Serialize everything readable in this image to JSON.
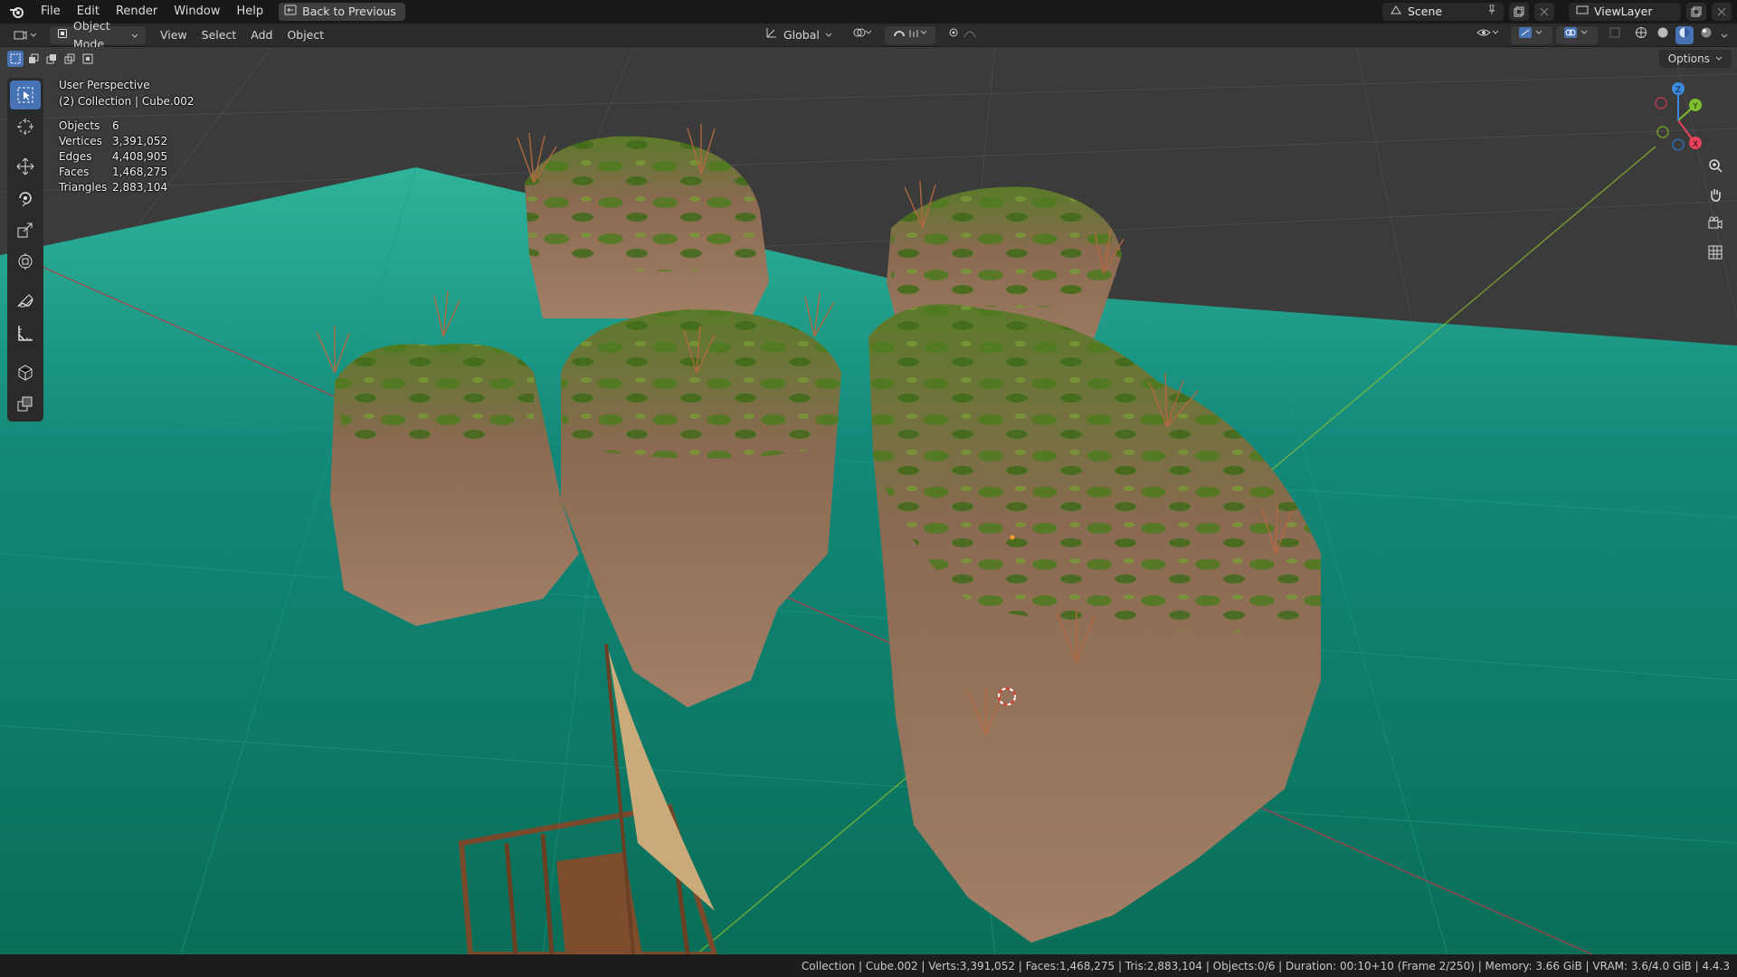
{
  "topbar": {
    "menus": [
      "File",
      "Edit",
      "Render",
      "Window",
      "Help"
    ],
    "back_label": "Back to Previous",
    "scene_name": "Scene",
    "viewlayer_name": "ViewLayer"
  },
  "header": {
    "mode": "Object Mode",
    "menus": [
      "View",
      "Select",
      "Add",
      "Object"
    ],
    "transform_orientation": "Global"
  },
  "viewport": {
    "options_label": "Options",
    "perspective": "User Perspective",
    "collection_line": "(2) Collection | Cube.002",
    "stats": [
      {
        "label": "Objects",
        "value": "6"
      },
      {
        "label": "Vertices",
        "value": "3,391,052"
      },
      {
        "label": "Edges",
        "value": "4,408,905"
      },
      {
        "label": "Faces",
        "value": "1,468,275"
      },
      {
        "label": "Triangles",
        "value": "2,883,104"
      }
    ],
    "gizmo": {
      "x": "X",
      "y": "Y",
      "z": "Z"
    }
  },
  "statusbar": {
    "text": "Collection | Cube.002 | Verts:3,391,052 | Faces:1,468,275 | Tris:2,883,104 | Objects:0/6 | Duration: 00:10+10 (Frame 2/250) | Memory: 3.66 GiB | VRAM: 3.6/4.0 GiB | 4.4.3"
  },
  "colors": {
    "accent": "#4772b3",
    "water": "#0f8a72",
    "axis_x": "#e8425a",
    "axis_y": "#7fbf2f",
    "axis_z": "#3a8be0"
  },
  "icons": [
    "blender-logo-icon",
    "back-icon",
    "scene-icon",
    "pin-icon",
    "viewlayer-icon",
    "editor-type-icon",
    "object-mode-icon",
    "orientation-icon",
    "pivot-icon",
    "snap-icon",
    "proportional-icon",
    "visibility-icon",
    "gizmo-icon",
    "overlay-icon",
    "xray-icon",
    "shading-wire-icon",
    "shading-solid-icon",
    "shading-material-icon",
    "shading-render-icon",
    "select-box-icon",
    "cursor-icon",
    "move-icon",
    "rotate-icon",
    "scale-icon",
    "transform-icon",
    "annotate-icon",
    "measure-icon",
    "add-cube-icon",
    "duplicate-icon",
    "zoom-icon",
    "pan-icon",
    "camera-icon",
    "grid-icon"
  ]
}
